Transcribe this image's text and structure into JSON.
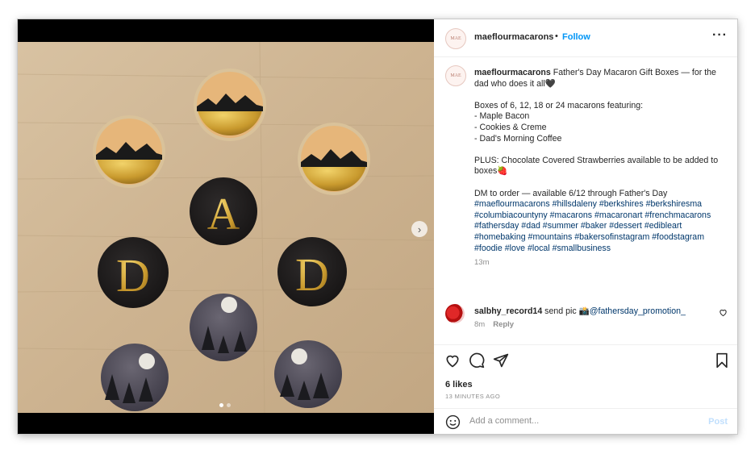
{
  "post": {
    "username": "maeflourmacarons",
    "separator": "•",
    "follow_label": "Follow",
    "more_icon": "more-horizontal-icon",
    "avatar_text": "MAE",
    "caption": {
      "username": "maeflourmacarons",
      "text": " Father's Day Macaron Gift Boxes — for the dad who does it all🖤\n\nBoxes of 6, 12, 18 or 24 macarons featuring:\n- Maple Bacon\n- Cookies & Creme\n- Dad's Morning Coffee\n\nPLUS: Chocolate Covered Strawberries available to be added to boxes🍓\n\nDM to order — available 6/12 through Father's Day\n",
      "hashtags": "#maeflourmacarons #hillsdaleny #berkshires #berkshiresma #columbiacountyny #macarons #macaronart #frenchmacarons #fathersday #dad #summer #baker #dessert #edibleart #homebaking #mountains #bakersofinstagram #foodstagram #foodie #love #local #smallbusiness",
      "time": "13m"
    },
    "comment": {
      "username": "salbhy_record14",
      "text": " send pic 📸",
      "mention": "@fathersday_promotion_",
      "time": "8m",
      "reply_label": "Reply"
    },
    "likes": "6 likes",
    "posted": "13 MINUTES AGO",
    "add_comment_placeholder": "Add a comment...",
    "post_label": "Post",
    "next_glyph": "›"
  },
  "colors": {
    "link": "#0095f6",
    "hashtag": "#00376b",
    "muted": "#8e8e8e"
  }
}
